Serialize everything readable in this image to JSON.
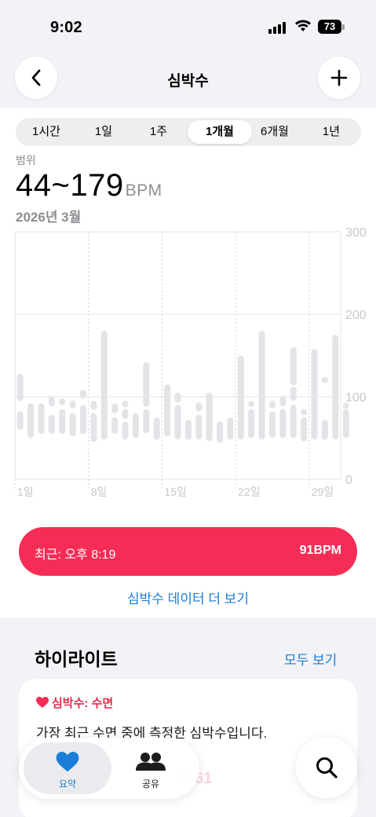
{
  "status": {
    "time": "9:02",
    "battery": "73"
  },
  "nav": {
    "title": "심박수"
  },
  "segments": [
    "1시간",
    "1일",
    "1주",
    "1개월",
    "6개월",
    "1년"
  ],
  "active_segment": "1개월",
  "summary": {
    "range_label": "범위",
    "range_value": "44~179",
    "unit": "BPM",
    "period": "2026년 3월"
  },
  "chart_data": {
    "type": "bar",
    "subtype": "range",
    "y_ticks": [
      "300",
      "200",
      "100",
      "0"
    ],
    "ylim": [
      0,
      300
    ],
    "x_labels": [
      {
        "day": 1,
        "label": "1일"
      },
      {
        "day": 8,
        "label": "8일"
      },
      {
        "day": 15,
        "label": "15일"
      },
      {
        "day": 22,
        "label": "22일"
      },
      {
        "day": 29,
        "label": "29일"
      }
    ],
    "days": 31,
    "ranges": [
      [
        [
          60,
          82
        ],
        [
          95,
          128
        ]
      ],
      [
        [
          50,
          92
        ]
      ],
      [
        [
          55,
          92
        ]
      ],
      [
        [
          55,
          78
        ],
        [
          88,
          100
        ]
      ],
      [
        [
          55,
          85
        ],
        [
          90,
          98
        ]
      ],
      [
        [
          52,
          80
        ],
        [
          86,
          95
        ]
      ],
      [
        [
          55,
          90
        ],
        [
          98,
          108
        ]
      ],
      [
        [
          45,
          80
        ],
        [
          84,
          95
        ]
      ],
      [
        [
          48,
          180
        ]
      ],
      [
        [
          55,
          75
        ],
        [
          80,
          92
        ]
      ],
      [
        [
          48,
          70
        ],
        [
          73,
          85
        ],
        [
          87,
          95
        ]
      ],
      [
        [
          50,
          80
        ]
      ],
      [
        [
          56,
          85
        ],
        [
          88,
          142
        ]
      ],
      [
        [
          48,
          75
        ]
      ],
      [
        [
          52,
          115
        ]
      ],
      [
        [
          48,
          90
        ],
        [
          93,
          105
        ]
      ],
      [
        [
          48,
          72
        ]
      ],
      [
        [
          48,
          78
        ],
        [
          82,
          93
        ]
      ],
      [
        [
          46,
          105
        ]
      ],
      [
        [
          44,
          70
        ]
      ],
      [
        [
          48,
          75
        ]
      ],
      [
        [
          48,
          150
        ]
      ],
      [
        [
          50,
          85
        ],
        [
          88,
          95
        ]
      ],
      [
        [
          48,
          180
        ]
      ],
      [
        [
          50,
          82
        ],
        [
          86,
          95
        ]
      ],
      [
        [
          50,
          85
        ],
        [
          88,
          100
        ]
      ],
      [
        [
          50,
          90
        ],
        [
          95,
          112
        ],
        [
          114,
          160
        ]
      ],
      [
        [
          46,
          75
        ],
        [
          80,
          85
        ]
      ],
      [
        [
          48,
          158
        ]
      ],
      [
        [
          48,
          72
        ],
        [
          117,
          124
        ]
      ],
      [
        [
          48,
          175
        ]
      ],
      [
        [
          50,
          85
        ],
        [
          88,
          93
        ]
      ]
    ]
  },
  "recent": {
    "label": "최근: 오후 8:19",
    "value": "91BPM"
  },
  "more_link": "심박수 데이터 더 보기",
  "highlights": {
    "title": "하이라이트",
    "see_all": "모두 보기",
    "card_tag": "심박수: 수면",
    "card_desc": "가장 최근 수면 중에 측정한 심박수입니다.",
    "card_faded": "대 61"
  },
  "tabs": [
    {
      "label": "요약"
    },
    {
      "label": "공유"
    }
  ],
  "colors": {
    "accent": "#f52d56",
    "link": "#1a7dd7",
    "bar": "#e3e3e8"
  }
}
